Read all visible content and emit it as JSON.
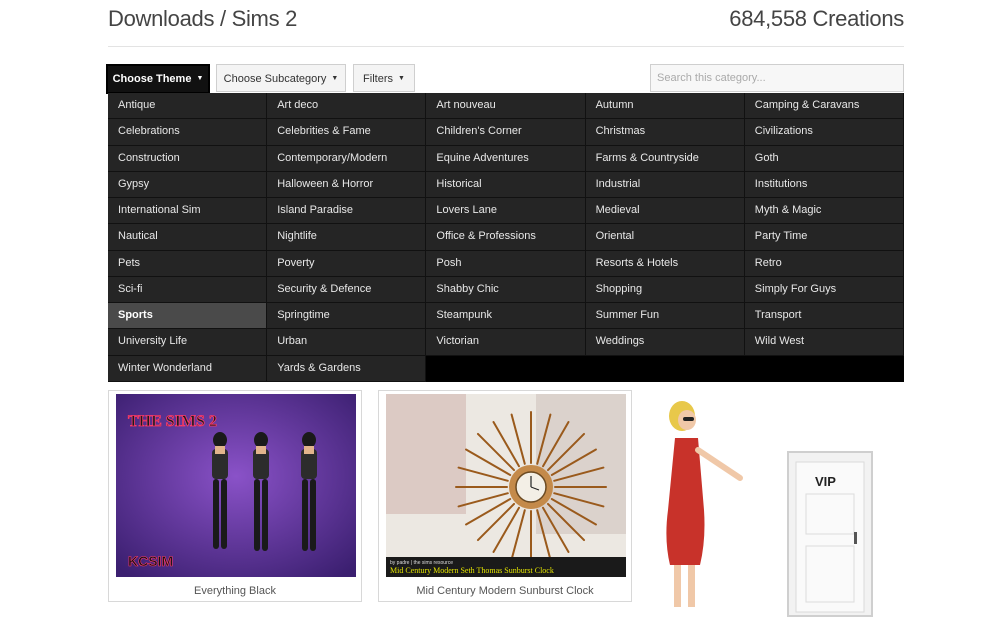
{
  "header": {
    "title": "Downloads / Sims 2",
    "count": "684,558 Creations"
  },
  "toolbar": {
    "theme_label": "Choose Theme",
    "subcategory_label": "Choose Subcategory",
    "filters_label": "Filters",
    "search_placeholder": "Search this category..."
  },
  "themes": [
    "Antique",
    "Art deco",
    "Art nouveau",
    "Autumn",
    "Camping & Caravans",
    "Celebrations",
    "Celebrities & Fame",
    "Children's Corner",
    "Christmas",
    "Civilizations",
    "Construction",
    "Contemporary/Modern",
    "Equine Adventures",
    "Farms & Countryside",
    "Goth",
    "Gypsy",
    "Halloween & Horror",
    "Historical",
    "Industrial",
    "Institutions",
    "International Sim",
    "Island Paradise",
    "Lovers Lane",
    "Medieval",
    "Myth & Magic",
    "Nautical",
    "Nightlife",
    "Office & Professions",
    "Oriental",
    "Party Time",
    "Pets",
    "Poverty",
    "Posh",
    "Resorts & Hotels",
    "Retro",
    "Sci-fi",
    "Security & Defence",
    "Shabby Chic",
    "Shopping",
    "Simply For Guys",
    "Sports",
    "Springtime",
    "Steampunk",
    "Summer Fun",
    "Transport",
    "University Life",
    "Urban",
    "Victorian",
    "Weddings",
    "Wild West",
    "Winter Wonderland",
    "Yards & Gardens"
  ],
  "selected_theme": "Sports",
  "cards": [
    {
      "caption": "Everything Black",
      "thumb_text": "THE SIMS 2",
      "watermark": "KCSIM"
    },
    {
      "caption": "Mid Century Modern Sunburst Clock",
      "credit": "by padre | the sims resource",
      "thumb_text": "Mid Century Modern Seth Thomas Sunburst Clock"
    }
  ],
  "ad": {
    "door_sign": "VIP"
  },
  "colors": {
    "menu_bg": "#252525",
    "selected": "#4a4a4a",
    "active_button": "#111111"
  }
}
